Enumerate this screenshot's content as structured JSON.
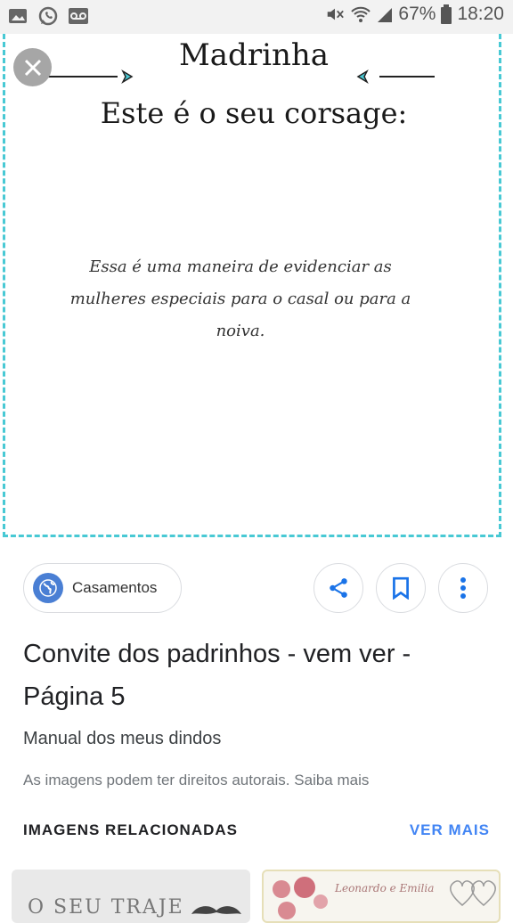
{
  "status_bar": {
    "battery": "67%",
    "time": "18:20"
  },
  "card": {
    "title": "Madrinha",
    "subtitle": "Este é o seu corsage:",
    "body": "Essa é uma maneira de evidenciar as mulheres especiais para o casal ou para a noiva.",
    "frame_color": "#48c9d4"
  },
  "source": {
    "label": "Casamentos"
  },
  "result": {
    "title": "Convite dos padrinhos - vem ver - Página 5",
    "site": "Manual dos meus dindos",
    "copyright": "As imagens podem ter direitos autorais.",
    "learn_more": "Saiba mais"
  },
  "related": {
    "header": "IMAGENS RELACIONADAS",
    "see_more": "VER MAIS",
    "thumb1_text": "O SEU TRAJE",
    "thumb2_text": "Leonardo e Emilia"
  },
  "icons": [
    "gallery-icon",
    "whatsapp-icon",
    "voicemail-icon",
    "mute-icon",
    "wifi-icon",
    "signal-icon",
    "battery-icon",
    "close-icon",
    "globe-icon",
    "share-icon",
    "bookmark-icon",
    "more-icon"
  ]
}
